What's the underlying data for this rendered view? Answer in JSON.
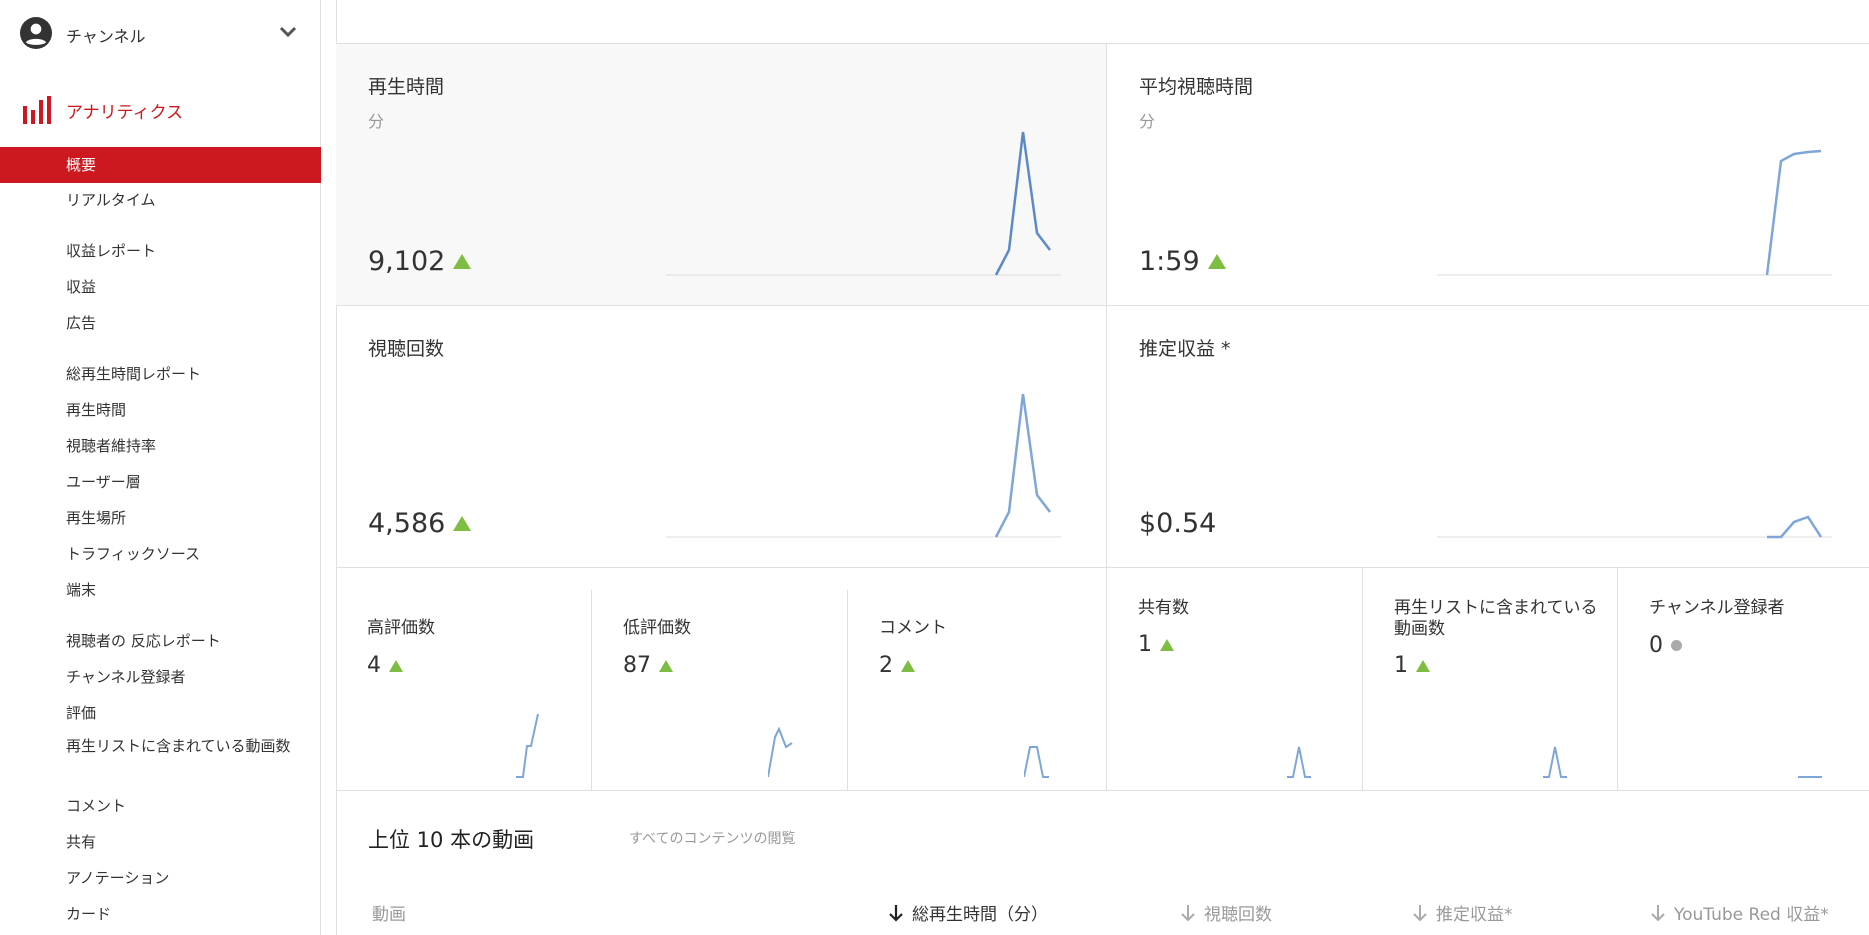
{
  "sidebar": {
    "channel_label": "チャンネル",
    "analytics_label": "アナリティクス",
    "items": [
      {
        "label": "概要",
        "active": true
      },
      {
        "label": "リアルタイム"
      },
      {
        "label": "収益レポート"
      },
      {
        "label": "収益"
      },
      {
        "label": "広告"
      },
      {
        "label": "総再生時間レポート"
      },
      {
        "label": "再生時間"
      },
      {
        "label": "視聴者維持率"
      },
      {
        "label": "ユーザー層"
      },
      {
        "label": "再生場所"
      },
      {
        "label": "トラフィックソース"
      },
      {
        "label": "端末"
      },
      {
        "label": "視聴者の 反応レポート"
      },
      {
        "label": "チャンネル登録者"
      },
      {
        "label": "評価"
      },
      {
        "label": "再生リストに含まれている動画数"
      },
      {
        "label": "コメント"
      },
      {
        "label": "共有"
      },
      {
        "label": "アノテーション"
      },
      {
        "label": "カード"
      }
    ]
  },
  "colors": {
    "accent": "#cc181e",
    "up": "#7cbd42",
    "line": "#6d97cf"
  },
  "cards": {
    "watch_time": {
      "title": "再生時間",
      "sub": "分",
      "value": "9,102",
      "trend": "up"
    },
    "avg_view": {
      "title": "平均視聴時間",
      "sub": "分",
      "value": "1:59",
      "trend": "up"
    },
    "views": {
      "title": "視聴回数",
      "value": "4,586",
      "trend": "up"
    },
    "revenue": {
      "title": "推定収益 *",
      "value": "$0.54"
    }
  },
  "minis": {
    "likes": {
      "title": "高評価数",
      "value": "4",
      "trend": "up"
    },
    "dislikes": {
      "title": "低評価数",
      "value": "87",
      "trend": "up"
    },
    "comments": {
      "title": "コメント",
      "value": "2",
      "trend": "up"
    },
    "shares": {
      "title": "共有数",
      "value": "1",
      "trend": "up"
    },
    "playlist": {
      "title": "再生リストに含まれている動画数",
      "value": "1",
      "trend": "up"
    },
    "subscribers": {
      "title": "チャンネル登録者",
      "value": "0",
      "trend": "flat"
    }
  },
  "top_videos": {
    "title": "上位 10 本の動画",
    "link": "すべてのコンテンツの閲覧",
    "columns": {
      "video": "動画",
      "watch_time": "総再生時間（分）",
      "views": "視聴回数",
      "revenue": "推定収益*",
      "red_revenue": "YouTube Red 収益*"
    }
  }
}
